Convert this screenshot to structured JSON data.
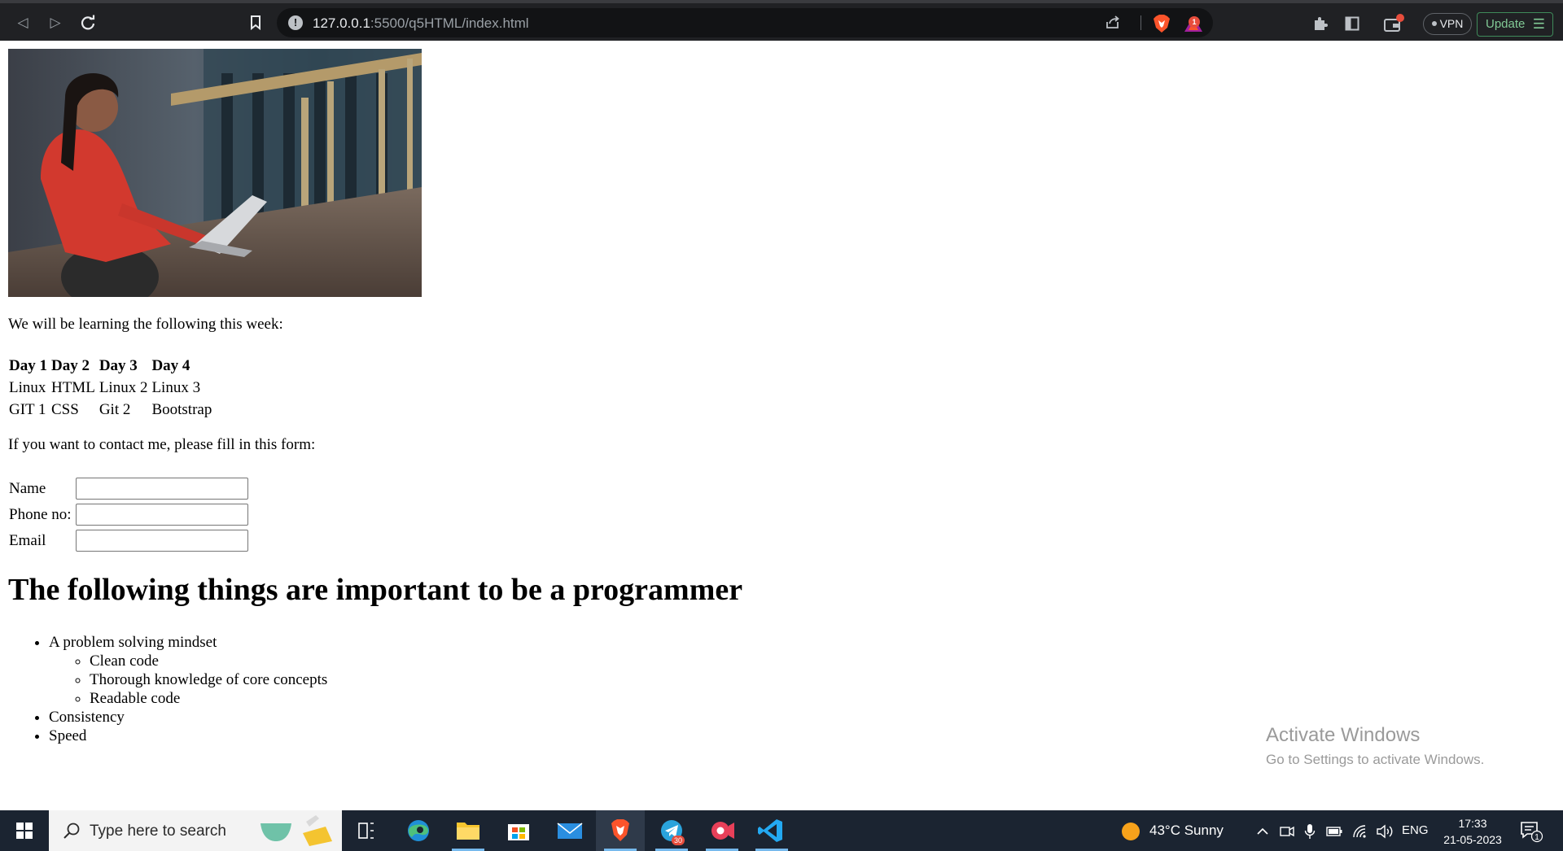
{
  "browser": {
    "url_host": "127.0.0.1",
    "url_path": ":5500/q5HTML/index.html",
    "rewards_badge": "1",
    "vpn_label": "VPN",
    "update_label": "Update"
  },
  "page": {
    "intro": "We will be learning the following this week:",
    "schedule": {
      "headers": [
        "Day 1",
        "Day 2",
        "Day 3",
        "Day 4"
      ],
      "rows": [
        [
          "Linux",
          "HTML",
          "Linux 2",
          "Linux 3"
        ],
        [
          "GIT 1",
          "CSS",
          "Git 2",
          "Bootstrap"
        ]
      ]
    },
    "contact_prompt": "If you want to contact me, please fill in this form:",
    "form": {
      "name_label": "Name",
      "phone_label": "Phone no:",
      "email_label": "Email"
    },
    "heading": "The following things are important to be a programmer",
    "list": {
      "item1": "A problem solving mindset",
      "sub1": "Clean code",
      "sub2": "Thorough knowledge of core concepts",
      "sub3": "Readable code",
      "item2": "Consistency",
      "item3": "Speed"
    }
  },
  "watermark": {
    "title": "Activate Windows",
    "subtitle": "Go to Settings to activate Windows."
  },
  "taskbar": {
    "search_placeholder": "Type here to search",
    "telegram_badge": "30",
    "weather": "43°C  Sunny",
    "language": "ENG",
    "time": "17:33",
    "date": "21-05-2023",
    "notification_count": "1"
  }
}
